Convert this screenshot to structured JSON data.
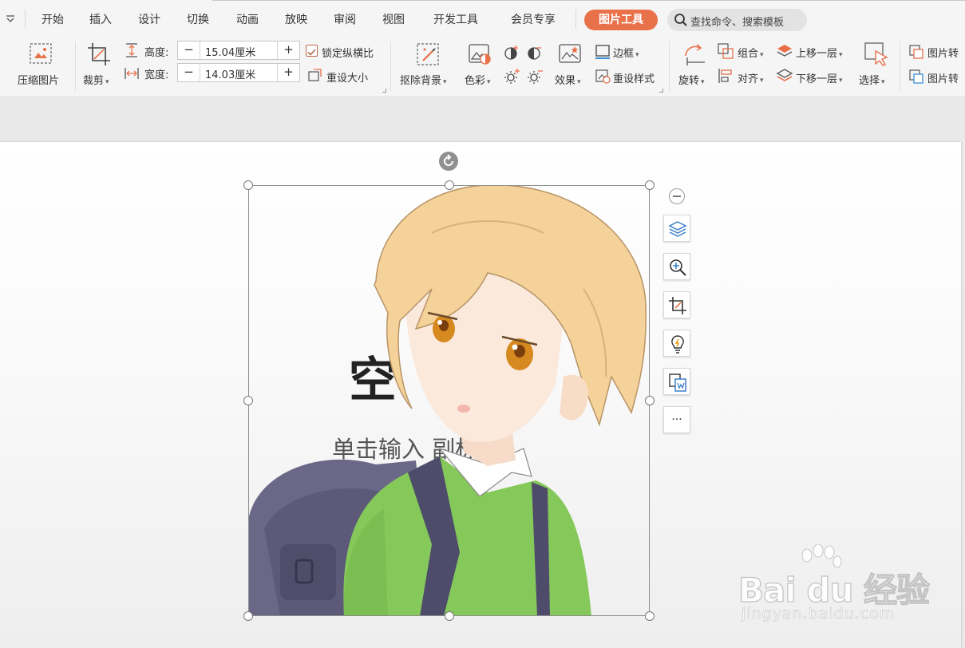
{
  "menu": {
    "tabs": [
      "开始",
      "插入",
      "设计",
      "切换",
      "动画",
      "放映",
      "审阅",
      "视图",
      "开发工具",
      "会员专享"
    ],
    "active_tab": "图片工具",
    "search_placeholder": "查找命令、搜索模板"
  },
  "ribbon": {
    "compress": "压缩图片",
    "crop": "裁剪",
    "height_label": "高度:",
    "height_value": "15.04厘米",
    "width_label": "宽度:",
    "width_value": "14.03厘米",
    "lock_ratio": "锁定纵横比",
    "reset_size": "重设大小",
    "remove_bg": "抠除背景",
    "color": "色彩",
    "effects": "效果",
    "border": "边框",
    "reset_style": "重设样式",
    "rotate": "旋转",
    "group": "组合",
    "align": "对齐",
    "bring_forward": "上移一层",
    "send_backward": "下移一层",
    "select": "选择",
    "pic_convert_1": "图片转",
    "pic_convert_2": "图片转",
    "minus": "−",
    "plus": "+"
  },
  "slide": {
    "title": "空",
    "subtitle": "单击输入    副标题"
  },
  "side_tools": [
    "layers",
    "zoom",
    "crop",
    "smart-beautify",
    "convert",
    "more"
  ],
  "more_label": "···",
  "watermark": {
    "brand": "Bai du 经验",
    "sub": "jingyan.baidu.com"
  },
  "colors": {
    "accent": "#e8714a",
    "ribbon_bg": "#f5f5f5",
    "workarea_bg": "#e9e9e9"
  }
}
